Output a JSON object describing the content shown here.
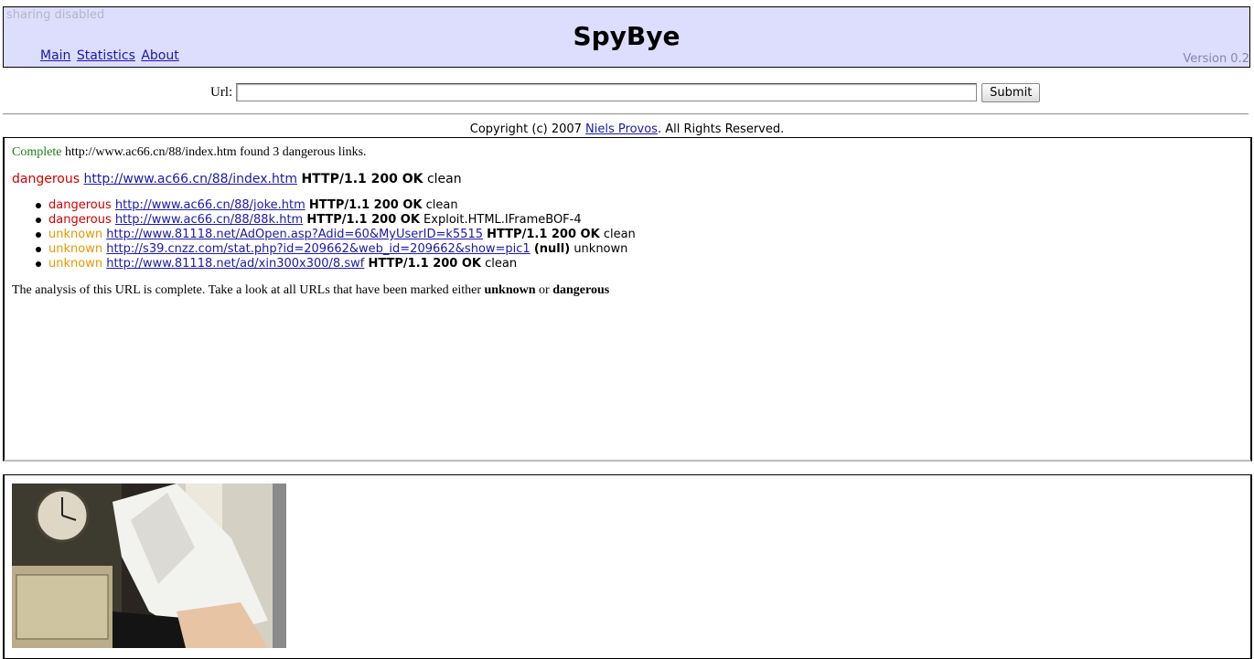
{
  "header": {
    "sharing": "sharing disabled",
    "title": "SpyBye",
    "version": "Version 0.2",
    "nav": [
      {
        "label": "Main"
      },
      {
        "label": "Statistics"
      },
      {
        "label": "About"
      }
    ]
  },
  "url_form": {
    "label": "Url:",
    "value": "",
    "submit_label": "Submit"
  },
  "copyright": {
    "prefix": "Copyright (c) 2007 ",
    "author": "Niels Provos",
    "suffix": ". All Rights Reserved."
  },
  "status": {
    "state": "Complete",
    "message": " http://www.ac66.cn/88/index.htm found 3 dangerous links."
  },
  "main_result": {
    "rating": "dangerous",
    "url": "http://www.ac66.cn/88/index.htm",
    "http": "HTTP/1.1 200 OK",
    "verdict": "clean"
  },
  "results": [
    {
      "rating": "dangerous",
      "url": "http://www.ac66.cn/88/joke.htm",
      "http": "HTTP/1.1 200 OK",
      "verdict": "clean"
    },
    {
      "rating": "dangerous",
      "url": "http://www.ac66.cn/88/88k.htm",
      "http": "HTTP/1.1 200 OK",
      "verdict": "Exploit.HTML.IFrameBOF-4"
    },
    {
      "rating": "unknown",
      "url": "http://www.81118.net/AdOpen.asp?Adid=60&MyUserID=k5515",
      "http": "HTTP/1.1 200 OK",
      "verdict": "clean"
    },
    {
      "rating": "unknown",
      "url": "http://s39.cnzz.com/stat.php?id=209662&web_id=209662&show=pic1",
      "http": "(null)",
      "verdict": "unknown"
    },
    {
      "rating": "unknown",
      "url": "http://www.81118.net/ad/xin300x300/8.swf",
      "http": "HTTP/1.1 200 OK",
      "verdict": "clean"
    }
  ],
  "summary": {
    "text": "The analysis of this URL is complete. Take a look at all URLs that have been marked either ",
    "unknown": "unknown",
    "or": " or ",
    "dangerous": "dangerous"
  },
  "colors": {
    "header_bg": "#ddddfd",
    "dangerous": "#d10000",
    "unknown": "#e59a00",
    "complete": "#1b7a1b",
    "link": "#1a1aa6"
  }
}
